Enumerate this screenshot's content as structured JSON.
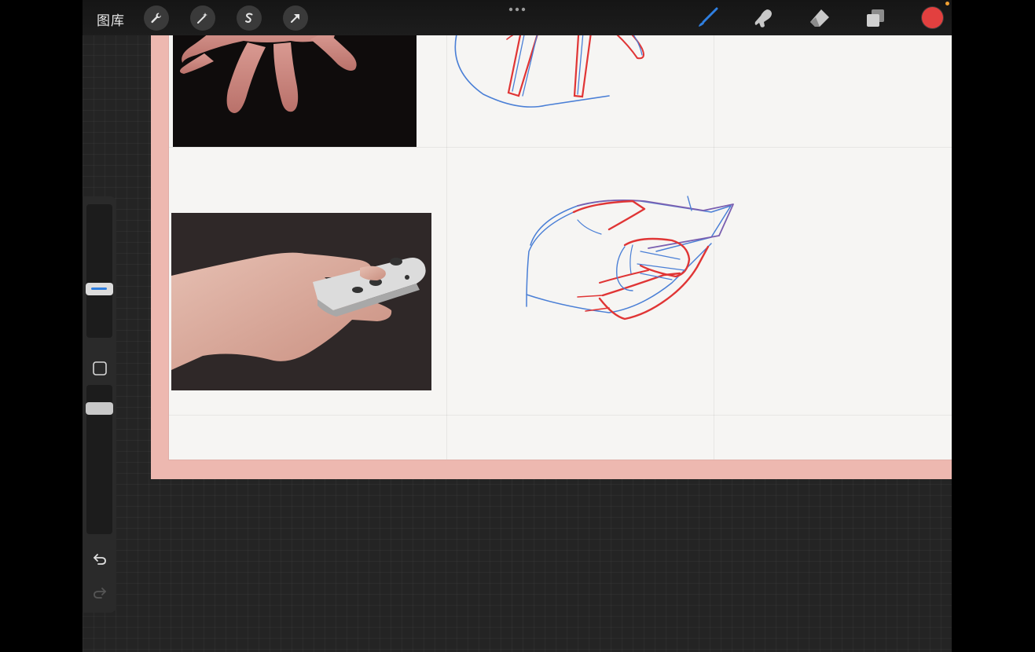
{
  "toolbar": {
    "gallery_label": "图库",
    "left_tools": [
      "wrench-icon",
      "magic-wand-icon",
      "selection-s-icon",
      "transform-arrow-icon"
    ],
    "right_tools": [
      "brush-icon",
      "smudge-icon",
      "eraser-icon",
      "layers-icon"
    ],
    "brush_active_color": "#2f7fe0",
    "current_color": "#e2403f",
    "recording_indicator_color": "#f0a032"
  },
  "canvas": {
    "frame_color": "#edb8b0",
    "paper_color": "#f6f5f3",
    "photo_refs": [
      "spread-hand-reference-photo",
      "hand-holding-remote-reference-photo"
    ],
    "sketch_colors": {
      "red": "#e03535",
      "blue": "#4a7fd6",
      "purple": "#7a5fb0"
    }
  },
  "sidebar": {
    "size_slider_level": 0.25,
    "opacity_slider_level": 0.5,
    "modify_button": "square-icon",
    "undo": "undo-icon",
    "redo": "redo-icon"
  }
}
